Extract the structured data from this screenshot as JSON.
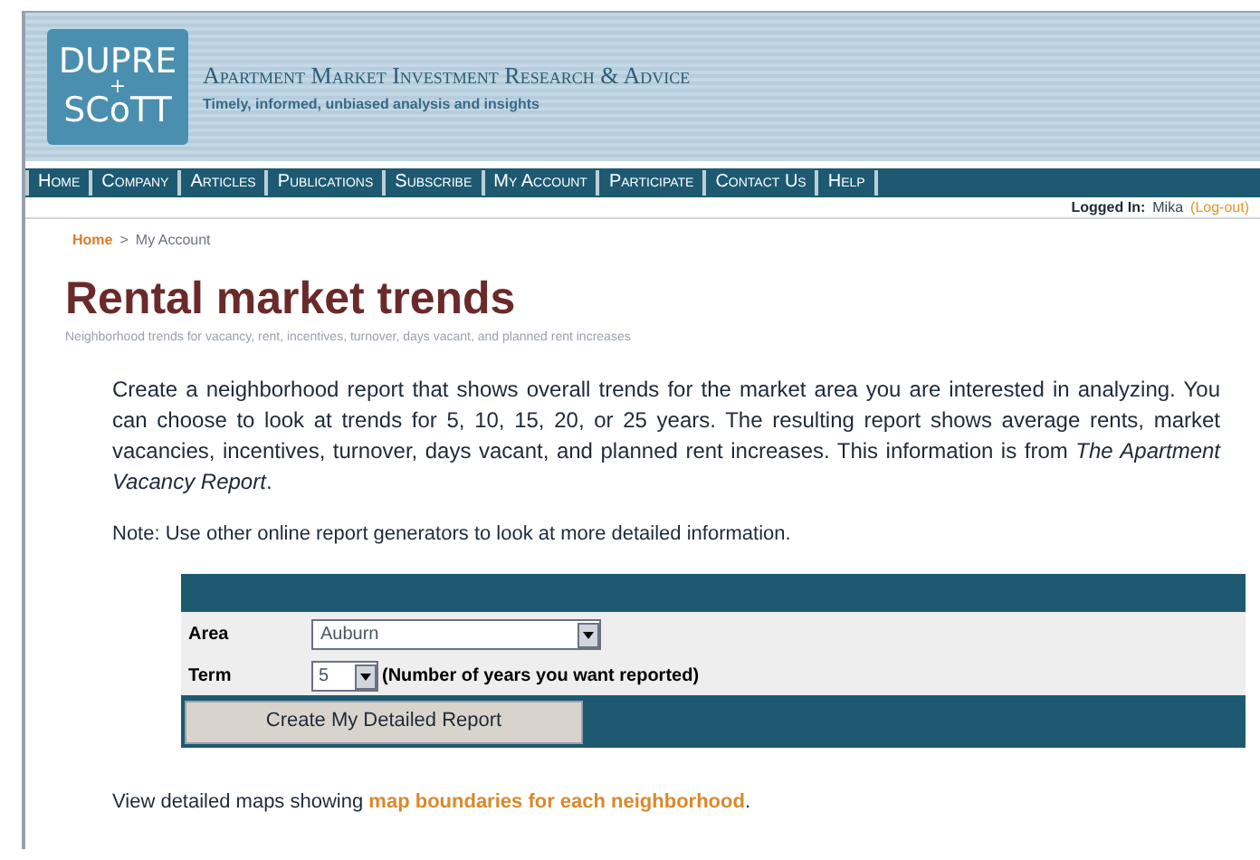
{
  "header": {
    "logo_top": "DUPRE",
    "logo_plus": "+",
    "logo_bottom": "SCoTT",
    "title": "Apartment Market Investment Research & Advice",
    "tagline": "Timely, informed, unbiased analysis and insights"
  },
  "nav": [
    {
      "label": "Home"
    },
    {
      "label": "Company"
    },
    {
      "label": "Articles"
    },
    {
      "label": "Publications"
    },
    {
      "label": "Subscribe"
    },
    {
      "label": "My Account"
    },
    {
      "label": "Participate"
    },
    {
      "label": "Contact Us"
    },
    {
      "label": "Help"
    }
  ],
  "login": {
    "label": "Logged In:",
    "user": "Mika",
    "logout": "(Log-out)"
  },
  "breadcrumb": [
    {
      "label": "Home",
      "kind": "link"
    },
    {
      "label": ">",
      "kind": "separator"
    },
    {
      "label": "My Account",
      "kind": "current"
    }
  ],
  "page_title": "Rental market trends",
  "subtitle": "Neighborhood trends for vacancy, rent, incentives, turnover, days vacant, and planned rent increases",
  "intro": "Create a neighborhood report that shows overall trends for the market area you are interested in analyzing. You can choose to look at trends for 5, 10, 15, 20, or 25 years. The resulting report shows average rents, market vacancies, incentives, turnover, days vacant, and planned rent increases. This information is from *The Apartment Vacancy Report*.",
  "note": "Note: Use other online report generators to look at more detailed information.",
  "form": {
    "area_label": "Area",
    "area_value": "Auburn",
    "term_label": "Term",
    "term_value": "5",
    "term_hint": "(Number of years you want reported)",
    "submit": "Create My Detailed Report"
  },
  "footer": {
    "text": "View detailed maps showing",
    "link": "map boundaries for each neighborhood",
    "end": "."
  }
}
